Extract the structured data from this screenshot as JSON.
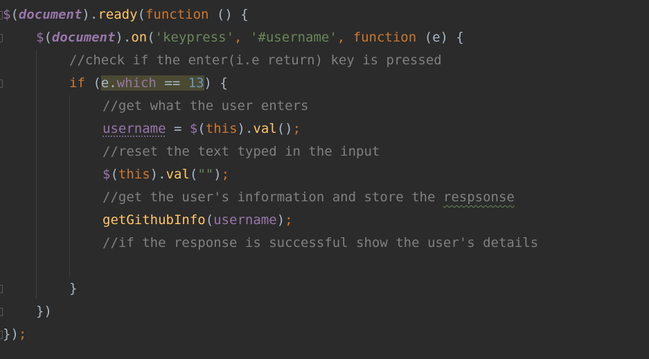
{
  "editor": {
    "lines": [
      {
        "tokens": [
          [
            "glob",
            "$"
          ],
          [
            "plain",
            "("
          ],
          [
            "doc",
            "document"
          ],
          [
            "plain",
            ")."
          ],
          [
            "fn",
            "ready"
          ],
          [
            "plain",
            "("
          ],
          [
            "kw",
            "function"
          ],
          [
            "plain",
            " () {"
          ]
        ]
      },
      {
        "tokens": [
          [
            "glob",
            "$"
          ],
          [
            "plain",
            "("
          ],
          [
            "doc",
            "document"
          ],
          [
            "plain",
            ")."
          ],
          [
            "fn",
            "on"
          ],
          [
            "plain",
            "("
          ],
          [
            "str",
            "'keypress'"
          ],
          [
            "kw",
            ", "
          ],
          [
            "str",
            "'#username'"
          ],
          [
            "kw",
            ", "
          ],
          [
            "kw",
            "function"
          ],
          [
            "plain",
            " (e) {"
          ]
        ]
      },
      {
        "tokens": [
          [
            "cm",
            "//check if the enter(i.e return) key is pressed"
          ]
        ]
      },
      {
        "tokens": [
          [
            "kw",
            "if "
          ],
          [
            "plain",
            "("
          ],
          [
            "hl",
            "e.which == 13"
          ],
          [
            "plain",
            ") {"
          ]
        ]
      },
      {
        "tokens": [
          [
            "cm",
            "//get what the user enters"
          ]
        ]
      },
      {
        "tokens": [
          [
            "squig",
            "username"
          ],
          [
            "plain",
            " = "
          ],
          [
            "glob",
            "$"
          ],
          [
            "plain",
            "("
          ],
          [
            "kw",
            "this"
          ],
          [
            "plain",
            ")."
          ],
          [
            "fn",
            "val"
          ],
          [
            "plain",
            "()"
          ],
          [
            "kw",
            ";"
          ]
        ]
      },
      {
        "tokens": [
          [
            "cm",
            "//reset the text typed in the input"
          ]
        ]
      },
      {
        "tokens": [
          [
            "glob",
            "$"
          ],
          [
            "plain",
            "("
          ],
          [
            "kw",
            "this"
          ],
          [
            "plain",
            ")."
          ],
          [
            "fn",
            "val"
          ],
          [
            "plain",
            "("
          ],
          [
            "str",
            "\"\""
          ],
          [
            "plain",
            ")"
          ],
          [
            "kw",
            ";"
          ]
        ]
      },
      {
        "tokens": [
          [
            "cm",
            "//get the user's information and store the "
          ],
          [
            "cmsq",
            "respsonse"
          ]
        ]
      },
      {
        "tokens": [
          [
            "fn",
            "getGithubInfo"
          ],
          [
            "plain",
            "("
          ],
          [
            "prop",
            "username"
          ],
          [
            "plain",
            ")"
          ],
          [
            "kw",
            ";"
          ]
        ]
      },
      {
        "tokens": [
          [
            "cm",
            "//if the response is successful show the user's details"
          ]
        ]
      },
      {
        "tokens": []
      },
      {
        "tokens": [
          [
            "plain",
            "}"
          ]
        ]
      },
      {
        "tokens": [
          [
            "plain",
            "})"
          ]
        ]
      },
      {
        "tokens": [
          [
            "plain",
            "})"
          ],
          [
            "kw",
            ";"
          ]
        ]
      }
    ],
    "highlight_parts": {
      "which_obj": "e.",
      "which_prop": "which",
      "op": " == ",
      "num": "13"
    }
  }
}
